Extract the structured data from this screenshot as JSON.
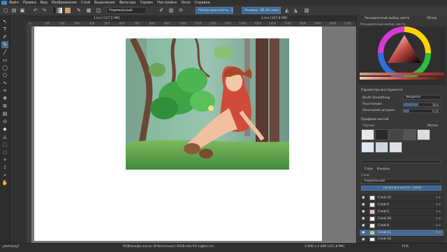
{
  "menu": {
    "items": [
      "Файл",
      "Правка",
      "Вид",
      "Изображение",
      "Слой",
      "Выделение",
      "Фильтры",
      "Сервис",
      "Настройка",
      "Окно",
      "Справка"
    ]
  },
  "toolbar": {
    "blend_mode": "Нормальный",
    "opacity": "Непрозрачность: 100%",
    "size": "Размер: 98,94 пикс."
  },
  "tabs": [
    {
      "label": "1.kra [117,5 Мб]"
    },
    {
      "label": "2.kra [107,8 Мб]"
    }
  ],
  "rulers": {
    "h_ticks": [
      "0",
      "100",
      "200",
      "300",
      "400",
      "500",
      "600",
      "700",
      "800",
      "900",
      "1000",
      "1100",
      "1200",
      "1300",
      "1400",
      "1500",
      "1600",
      "1700",
      "1800",
      "1900",
      "2000",
      "2100"
    ]
  },
  "docker": {
    "color_header": "Расширенный выбор цвета",
    "overview_tab": "Обзор",
    "color_sub": "Расширенный выбор цвета",
    "tool_options": "Параметры инструмента",
    "brush_smoothing_label": "Brush Smoothing:",
    "brush_smoothing_value": "Weighted",
    "distance_label": "Расстояние:",
    "distance_value": "50,0",
    "stroke_end_label": "Окончание штриха:",
    "stroke_end_value": "0,15",
    "brush_presets_title": "Профили кистей",
    "presets_filter": "Чёрнил",
    "tag_label": "Метка",
    "layers_tab1": "Слои",
    "layers_tab2": "Каналы",
    "layers_title": "Слои",
    "layers_blend": "Нормальный",
    "layers_opacity": "Непрозрачность: 100%",
    "layers": [
      {
        "name": "Слой 10",
        "selected": false
      },
      {
        "name": "Слой 9",
        "selected": false
      },
      {
        "name": "Слой 5",
        "selected": false
      },
      {
        "name": "Слой 18",
        "selected": false
      },
      {
        "name": "Слой 8",
        "selected": false
      },
      {
        "name": "Слой 11",
        "selected": true
      },
      {
        "name": "Слой 16",
        "selected": false
      }
    ]
  },
  "status": {
    "tool": "pbstalyaj2",
    "color_profile": "RGB/альфа-канал (8-бит/канал)  sRGB-elle-V2-srgbtrc.icc",
    "dimensions": "3 000 x 2 000 (107,8 Мб)",
    "zoom": "15%"
  },
  "colors": {
    "accent": "#4a6a8e",
    "ui_dark": "#323232",
    "selected_layer": "#4a6a8e"
  }
}
